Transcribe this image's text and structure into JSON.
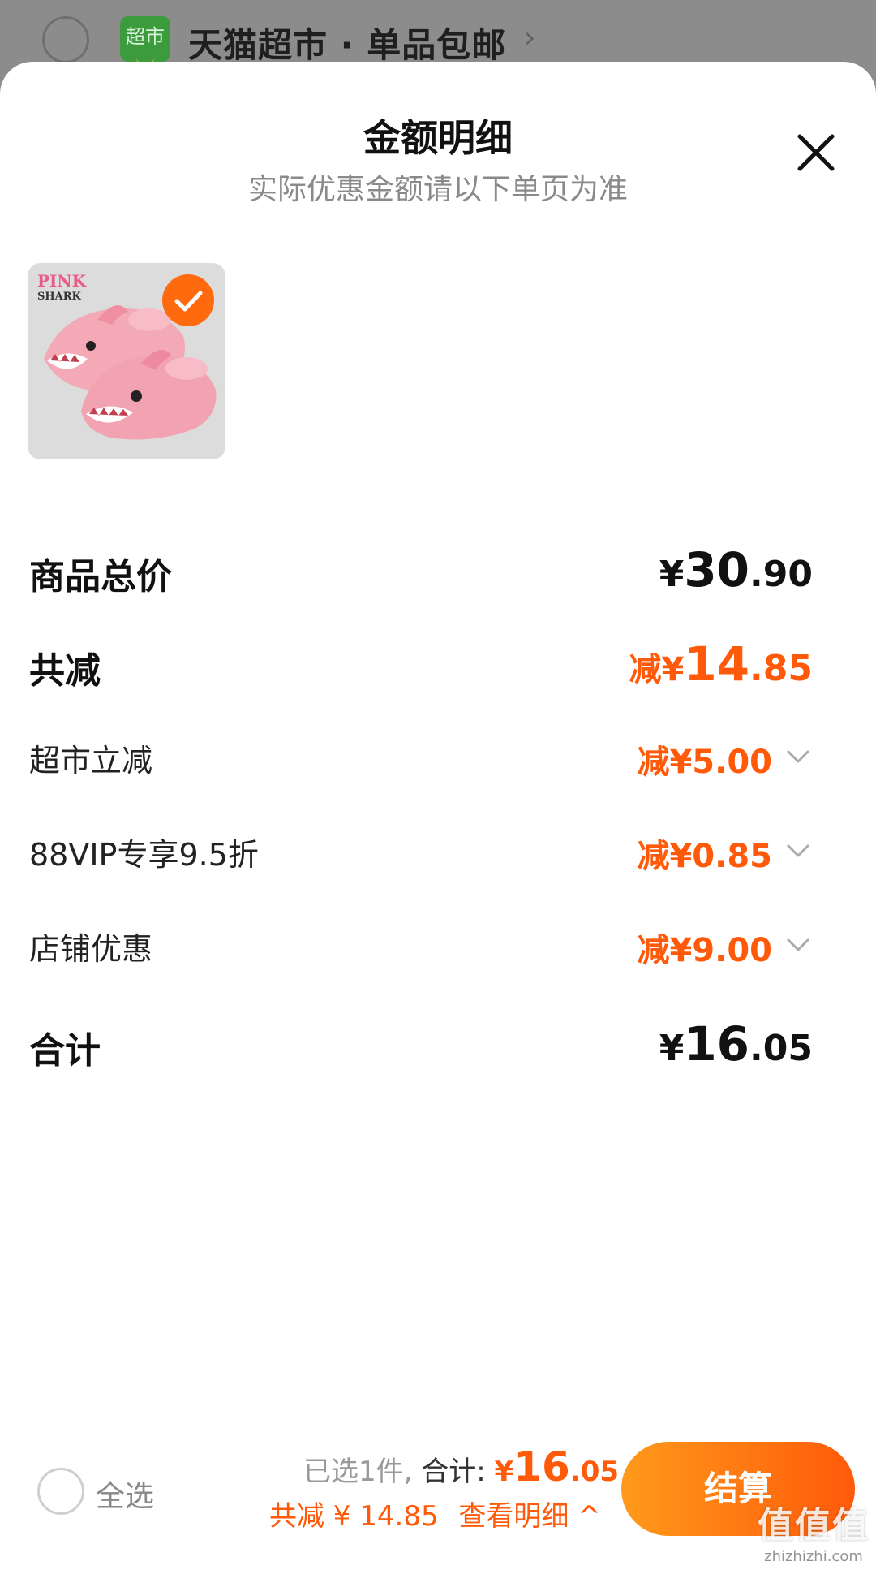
{
  "background": {
    "store_badge": "超市",
    "store_title": "天猫超市 · 单品包邮"
  },
  "sheet": {
    "title": "金额明细",
    "subtitle": "实际优惠金额请以下单页为准",
    "product": {
      "image_text_1": "PINK",
      "image_text_2": "SHARK"
    }
  },
  "rows": {
    "total_price": {
      "label": "商品总价",
      "yen": "¥",
      "int": "30",
      "dec": ".90"
    },
    "total_discount": {
      "label": "共减",
      "prefix": "减¥",
      "int": "14",
      "dec": ".85"
    },
    "discounts": [
      {
        "label": "超市立减",
        "value": "减¥5.00"
      },
      {
        "label": "88VIP专享9.5折",
        "value": "减¥0.85"
      },
      {
        "label": "店铺优惠",
        "value": "减¥9.00"
      }
    ],
    "grand_total": {
      "label": "合计",
      "yen": "¥",
      "int": "16",
      "dec": ".05"
    }
  },
  "bottom": {
    "select_all": "全选",
    "selected_text": "已选1件,",
    "total_label": "合计:",
    "total_yen": "¥",
    "total_int": "16",
    "total_dec": ".05",
    "discount_text": "共减 ¥ 14.85",
    "view_detail": "查看明细 ^",
    "checkout": "结算"
  },
  "watermark": {
    "main": "值值值",
    "small": "zhizhizhi.com"
  },
  "colors": {
    "accent": "#ff5a0a",
    "gradient_start": "#ff9a1a"
  }
}
